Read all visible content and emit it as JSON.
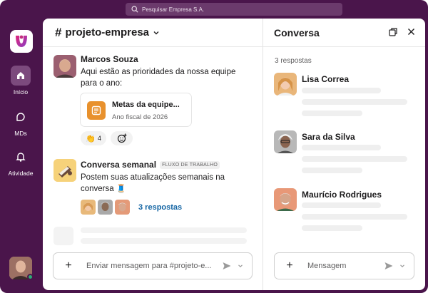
{
  "search": {
    "placeholder": "Pesquisar Empresa S.A."
  },
  "rail": {
    "items": [
      {
        "label": "Início",
        "icon": "home-icon",
        "active": true
      },
      {
        "label": "MDs",
        "icon": "dm-icon",
        "active": false
      },
      {
        "label": "Atividade",
        "icon": "bell-icon",
        "active": false
      }
    ]
  },
  "channel": {
    "hash": "#",
    "name": "projeto-empresa"
  },
  "messages": [
    {
      "author": "Marcos Souza",
      "text": "Aqui estão as prioridades da nossa equipe para o ano:",
      "card": {
        "title": "Metas da equipe...",
        "subtitle": "Ano fiscal de 2026"
      },
      "reaction": {
        "emoji": "👏",
        "count": "4"
      }
    },
    {
      "author": "Conversa semanal",
      "tag": "FLUXO DE TRABALHO",
      "text": "Postem suas atualizações semanais na conversa 🧵",
      "replies": "3 respostas"
    }
  ],
  "composer": {
    "placeholder": "Enviar mensagem para #projeto-e..."
  },
  "thread": {
    "title": "Conversa",
    "count": "3 respostas",
    "users": [
      "Lisa Correa",
      "Sara da Silva",
      "Maurício Rodrigues"
    ],
    "composer_placeholder": "Mensagem"
  },
  "colors": {
    "aubergine": "#4a154b",
    "link": "#1264a3",
    "card_icon": "#e8912d",
    "presence": "#2bac76"
  }
}
